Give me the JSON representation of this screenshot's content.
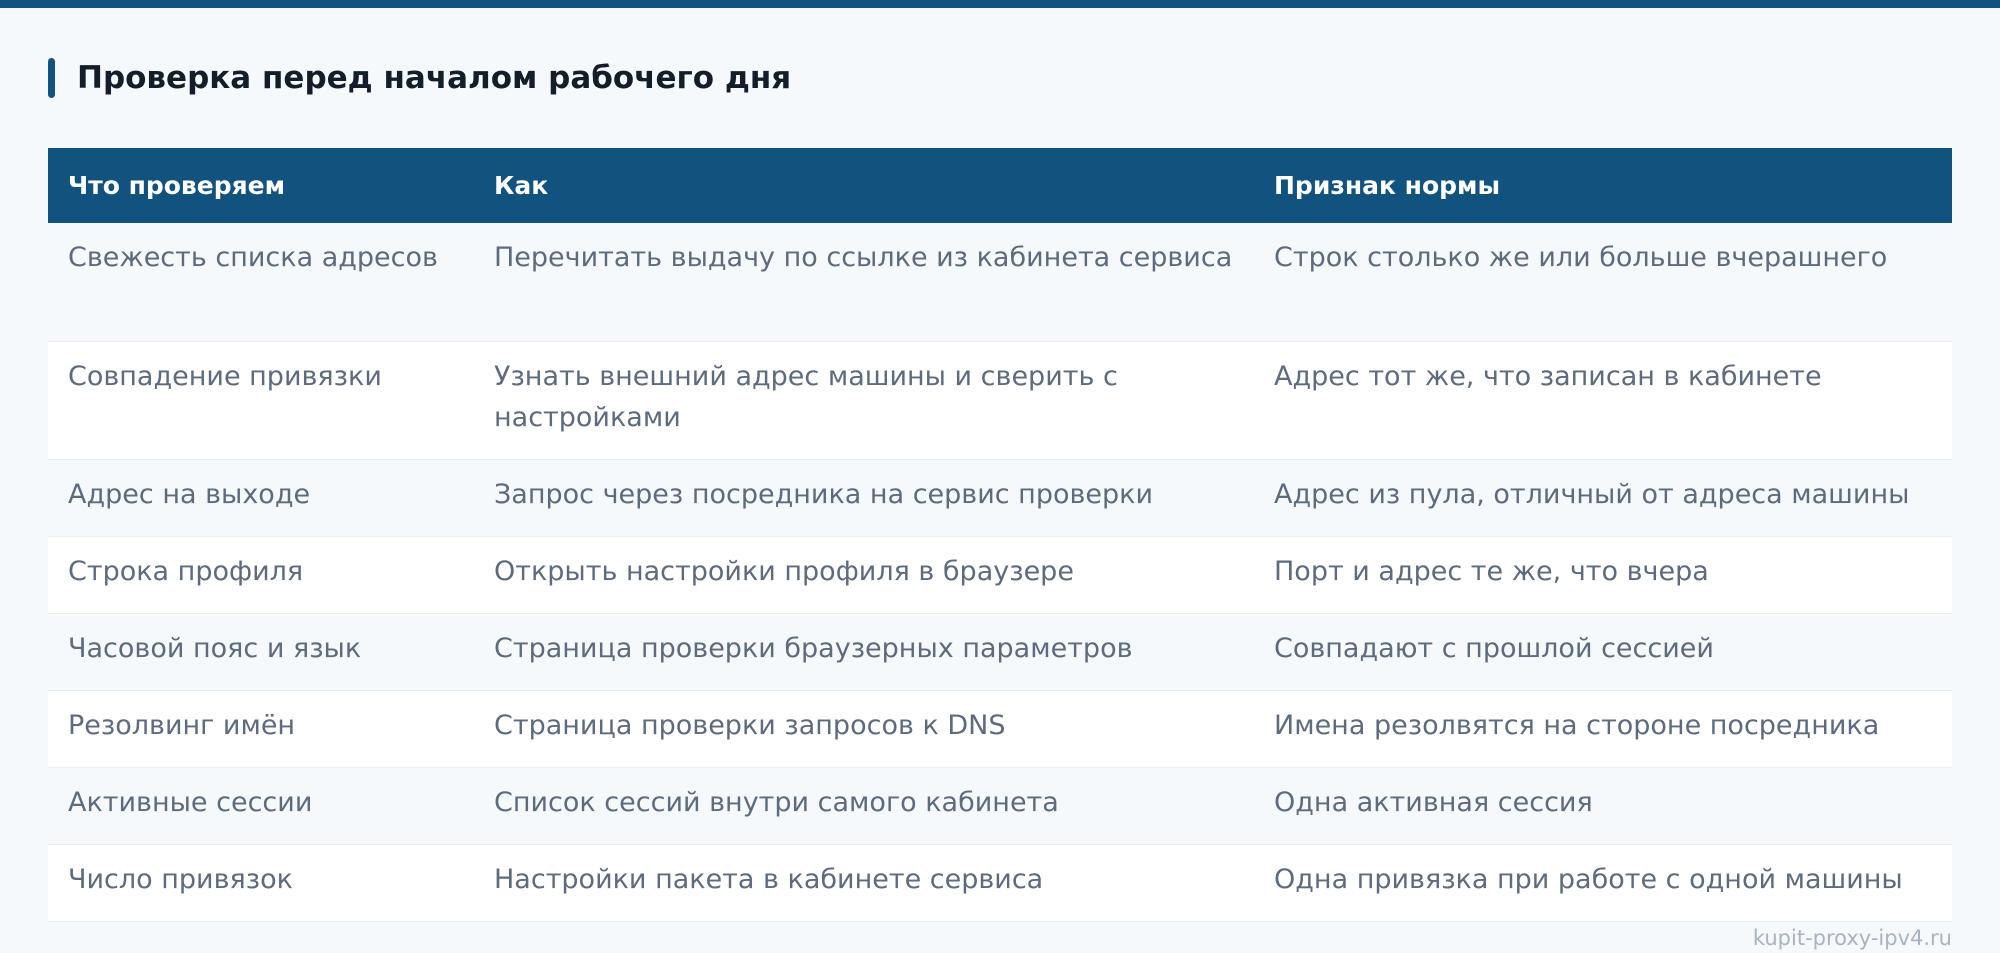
{
  "section": {
    "title": "Проверка перед началом рабочего дня"
  },
  "table": {
    "headers": [
      "Что проверяем",
      "Как",
      "Признак нормы"
    ],
    "rows": [
      [
        "Свежесть списка адресов",
        "Перечитать выдачу по ссылке из кабинета сервиса",
        "Строк столько же или больше вчерашнего"
      ],
      [
        "Совпадение привязки",
        "Узнать внешний адрес машины и сверить с настройками",
        "Адрес тот же, что записан в кабинете"
      ],
      [
        "Адрес на выходе",
        "Запрос через посредника на сервис проверки",
        "Адрес из пула, отличный от адреса машины"
      ],
      [
        "Строка профиля",
        "Открыть настройки профиля в браузере",
        "Порт и адрес те же, что вчера"
      ],
      [
        "Часовой пояс и язык",
        "Страница проверки браузерных параметров",
        "Совпадают с прошлой сессией"
      ],
      [
        "Резолвинг имён",
        "Страница проверки запросов к DNS",
        "Имена резолвятся на стороне посредника"
      ],
      [
        "Активные сессии",
        "Список сессий внутри самого кабинета",
        "Одна активная сессия"
      ],
      [
        "Число привязок",
        "Настройки пакета в кабинете сервиса",
        "Одна привязка при работе с одной машины"
      ]
    ]
  },
  "watermark": "kupit-proxy-ipv4.ru",
  "colors": {
    "accent": "#12527f",
    "background": "#f6f9fc",
    "text": "#5d6b7d",
    "heading": "#141e2b"
  }
}
